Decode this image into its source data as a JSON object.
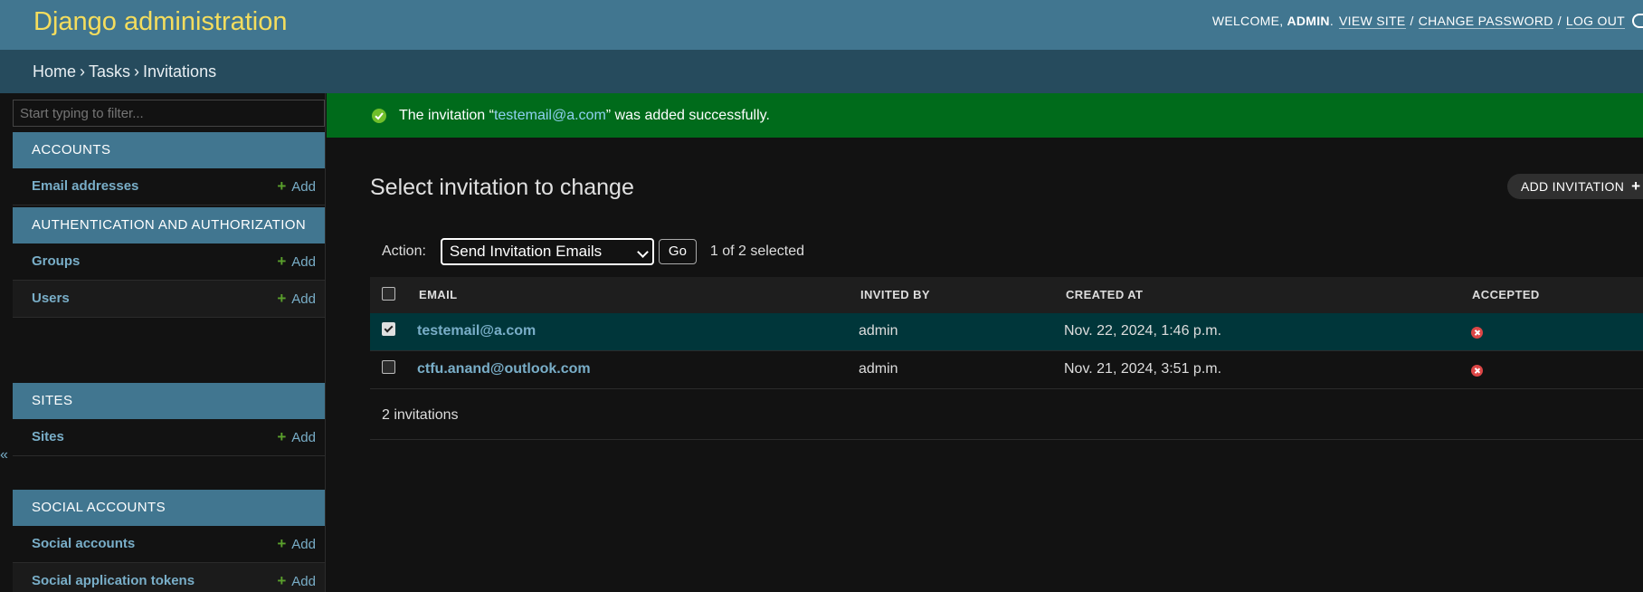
{
  "header": {
    "site_title": "Django administration",
    "welcome": "WELCOME,",
    "username": "ADMIN",
    "view_site": "VIEW SITE",
    "change_password": "CHANGE PASSWORD",
    "log_out": "LOG OUT",
    "separator": "/"
  },
  "breadcrumbs": [
    "Home",
    "Tasks",
    "Invitations"
  ],
  "sidebar": {
    "filter_placeholder": "Start typing to filter...",
    "add_label": "Add",
    "modules": [
      {
        "caption": "ACCOUNTS",
        "models": [
          "Email addresses"
        ]
      },
      {
        "caption": "AUTHENTICATION AND AUTHORIZATION",
        "models": [
          "Groups",
          "Users"
        ]
      },
      {
        "caption": "SITES",
        "models": [
          "Sites"
        ]
      },
      {
        "caption": "SOCIAL ACCOUNTS",
        "models": [
          "Social accounts",
          "Social application tokens"
        ]
      }
    ],
    "collapse_glyph": "«"
  },
  "message": {
    "prefix": "The invitation “",
    "link": "testemail@a.com",
    "suffix": "” was added successfully."
  },
  "content": {
    "title": "Select invitation to change",
    "add_button": "ADD INVITATION",
    "action_label": "Action:",
    "action_selected": "Send Invitation Emails",
    "go_label": "Go",
    "selected_count": "1 of 2 selected"
  },
  "table": {
    "headers": [
      "EMAIL",
      "INVITED BY",
      "CREATED AT",
      "ACCEPTED"
    ],
    "rows": [
      {
        "email": "testemail@a.com",
        "invited_by": "admin",
        "created_at": "Nov. 22, 2024, 1:46 p.m.",
        "accepted": false,
        "selected": true
      },
      {
        "email": "ctfu.anand@outlook.com",
        "invited_by": "admin",
        "created_at": "Nov. 21, 2024, 3:51 p.m.",
        "accepted": false,
        "selected": false
      }
    ]
  },
  "paginator": "2 invitations",
  "colors": {
    "header_bg": "#417690",
    "breadcrumb_bg": "#264b5d",
    "title_yellow": "#f5dd5d",
    "success_bg": "#006b1b",
    "link_blue": "#79aec8",
    "selected_row_bg": "#00363a"
  }
}
